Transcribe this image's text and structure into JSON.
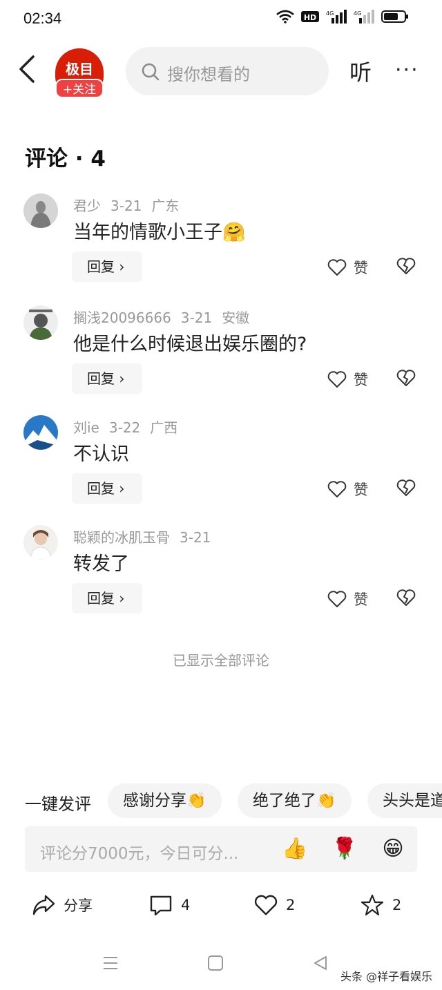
{
  "status_bar": {
    "time": "02:34",
    "hd_label": "HD",
    "net1": "4G",
    "net2": "4G"
  },
  "nav": {
    "logo_text": "极目",
    "follow_label": "+关注",
    "search_placeholder": "搜你想看的",
    "listen_label": "听",
    "more_label": "···"
  },
  "section": {
    "title": "评论 · 4"
  },
  "comments": [
    {
      "user": "君少",
      "date": "3-21",
      "region": "广东",
      "text": "当年的情歌小王子🤗",
      "reply_label": "回复 ›",
      "like_label": "赞"
    },
    {
      "user": "搁浅20096666",
      "date": "3-21",
      "region": "安徽",
      "text": "他是什么时候退出娱乐圈的?",
      "reply_label": "回复 ›",
      "like_label": "赞"
    },
    {
      "user": "刘ie",
      "date": "3-22",
      "region": "广西",
      "text": "不认识",
      "reply_label": "回复 ›",
      "like_label": "赞"
    },
    {
      "user": "聪颖的冰肌玉骨",
      "date": "3-21",
      "region": "",
      "text": "转发了",
      "reply_label": "回复 ›",
      "like_label": "赞"
    }
  ],
  "end_note": "已显示全部评论",
  "quick_comment": {
    "label": "一键发评",
    "chips": [
      "感谢分享👏",
      "绝了绝了👏",
      "头头是道"
    ]
  },
  "input": {
    "placeholder": "评论分7000元，今日可分...",
    "emojis": [
      "👍",
      "🌹",
      "😁"
    ]
  },
  "actions": {
    "share_label": "分享",
    "comment_count": "4",
    "like_count": "2",
    "favorite_count": "2"
  },
  "watermark": "头条 @祥子看娱乐"
}
